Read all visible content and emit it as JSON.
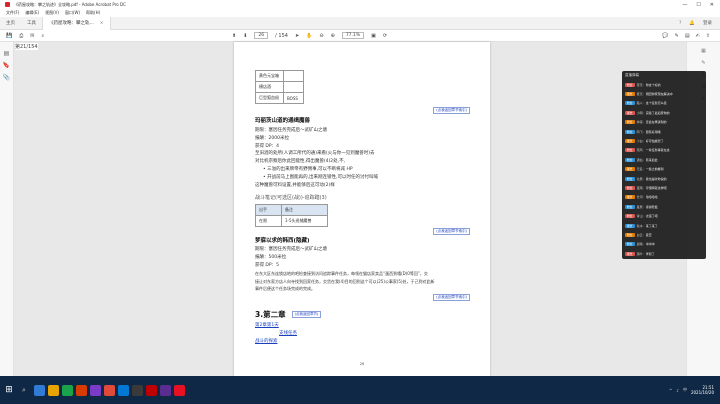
{
  "window": {
    "title": "《药屋攻略：攀之轨迹》全攻略.pdf - Adobe Acrobat Pro DC",
    "controls": [
      "—",
      "☐",
      "✕"
    ]
  },
  "menu": [
    "文件(F)",
    "编辑(E)",
    "视图(V)",
    "窗口(W)",
    "帮助(H)"
  ],
  "tabs": {
    "home": "主页",
    "tools": "工具",
    "document": "《药屋攻略：攀之轨...",
    "close": "×",
    "signin": "登录"
  },
  "toolbar": {
    "left_icons": [
      "save-icon",
      "print-icon",
      "mail-icon",
      "search-icon"
    ],
    "page_current": "26",
    "page_total": "/ 154",
    "zoom": "77.1%",
    "right_icons": [
      "comment-icon",
      "pen-icon",
      "highlight-icon",
      "sign-icon",
      "share-icon"
    ]
  },
  "viewer": {
    "page_label": "第21/154"
  },
  "pdf_page": {
    "table1": [
      "黄色元宝箱",
      "横店酒",
      "巨型狐血殺",
      "BOSS"
    ],
    "link_back": "(点我返回章节索引)",
    "section1": {
      "title": "玛丽茨山道的通缉魔兽",
      "lines": [
        "期限：塞因任务完成后～武矿山之塘",
        "报酬：2000米拉",
        "获得 DP：4",
        "至旧酒的处所(人调工所代的通)来看(火与你一见到魔兽时)去",
        "对比机宗察后你此回能性,得出魔兽(4)2处,不,",
        "• 三溢的出来牌帝有野佣事,可以不断将减 HP",
        "• 开战前马上图能再的,出来刚连锁性,可以时任的讨付叫喊",
        "这种魔兽可料设置,并能够后这可动(2)样"
      ]
    },
    "subheading": "战斗笔记(可选区(战))-追踪踏(3)",
    "table2": {
      "header": [
        "出手",
        "备注"
      ],
      "row": [
        "在限",
        "1-5头巡捕魔兽"
      ]
    },
    "section2": {
      "title": "梦寐以求的韩西(隐藏)",
      "lines": [
        "期限：塞因任务完成后～武矿山之塘",
        "报酬：500米拉",
        "获得 DP：5",
        "在东大区东连锁店地的吧检查接到访问追踪事件任务，每领在猫店家卖品“蛋西到嘻(D)0等回”，交",
        "接让对东家方店人向寺找到回家任务，交货在我(4)目的回到这个可以(25)公事家(5)处，于己到对此新",
        "事件后便这个任务场完成的完成。"
      ]
    },
    "chapter": "3.第二章",
    "chapter_link": "(点我返回章节)",
    "toc": [
      "第2章第1天",
      "支线任务",
      "战斗的探索"
    ],
    "page_number": "26"
  },
  "chat": {
    "header": "直播弹幕",
    "messages": [
      {
        "badge": "粉丝",
        "badge_color": "#d9534f",
        "user": "苍天:",
        "text": "你这个好的"
      },
      {
        "badge": "舰长",
        "badge_color": "#e07b00",
        "user": "夏天:",
        "text": "刚回你家现在解决中"
      },
      {
        "badge": "粉丝",
        "badge_color": "#2a8fd6",
        "user": "路人:",
        "text": "这个任务怎么接"
      },
      {
        "badge": "舰长",
        "badge_color": "#d9534f",
        "user": "小明:",
        "text": "实验了最后家你的"
      },
      {
        "badge": "粉丝",
        "badge_color": "#e07b00",
        "user": "帅哥:",
        "text": "还会在再讲到的"
      },
      {
        "badge": "粉丝",
        "badge_color": "#2a8fd6",
        "user": "阿飞:",
        "text": "很有好用哦"
      },
      {
        "badge": "舰长",
        "badge_color": "#e07b00",
        "user": "小白:",
        "text": "好可怕魔兽了"
      },
      {
        "badge": "粉丝",
        "badge_color": "#d9534f",
        "user": "南风:",
        "text": "一条任务等就在这"
      },
      {
        "badge": "粉丝",
        "badge_color": "#2a8fd6",
        "user": "酒仙:",
        "text": "原来如此"
      },
      {
        "badge": "舰长",
        "badge_color": "#e07b00",
        "user": "无名:",
        "text": "一些之前看到"
      },
      {
        "badge": "粉丝",
        "badge_color": "#2a8fd6",
        "user": "北辰:",
        "text": "我也是听你说的"
      },
      {
        "badge": "粉丝",
        "badge_color": "#d9534f",
        "user": "夜雨:",
        "text": "可惜啊就这样吧"
      },
      {
        "badge": "舰长",
        "badge_color": "#e07b00",
        "user": "长河:",
        "text": "哈哈哈哈"
      },
      {
        "badge": "粉丝",
        "badge_color": "#2a8fd6",
        "user": "星辰:",
        "text": "感谢老板"
      },
      {
        "badge": "粉丝",
        "badge_color": "#d9534f",
        "user": "青山:",
        "text": "太强了吧"
      },
      {
        "badge": "舰长",
        "badge_color": "#2a8fd6",
        "user": "秋水:",
        "text": "来了来了"
      },
      {
        "badge": "粉丝",
        "badge_color": "#e07b00",
        "user": "白云:",
        "text": "赞赏"
      },
      {
        "badge": "粉丝",
        "badge_color": "#2a8fd6",
        "user": "晨曦:",
        "text": "冲冲冲"
      },
      {
        "badge": "舰长",
        "badge_color": "#d9534f",
        "user": "落叶:",
        "text": "学到了"
      }
    ]
  },
  "taskbar": {
    "start": "⊞",
    "search": "⌕",
    "app_colors": [
      "#2f7bd6",
      "#e8a400",
      "#1aa34a",
      "#d83b01",
      "#7a3cc7",
      "#e04a3a",
      "#0078d4",
      "#3a3a3a",
      "#c00000",
      "#5c2d91",
      "#e81123"
    ],
    "time": "21:51",
    "date": "2021/10/20",
    "tray_icons": [
      "^",
      "♪",
      "中"
    ]
  }
}
